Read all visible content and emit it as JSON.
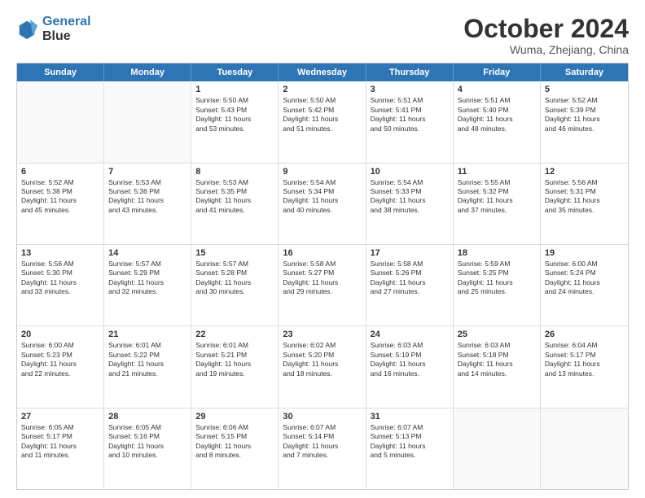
{
  "header": {
    "logo_line1": "General",
    "logo_line2": "Blue",
    "month_title": "October 2024",
    "location": "Wuma, Zhejiang, China"
  },
  "weekdays": [
    "Sunday",
    "Monday",
    "Tuesday",
    "Wednesday",
    "Thursday",
    "Friday",
    "Saturday"
  ],
  "weeks": [
    [
      {
        "day": "",
        "info": ""
      },
      {
        "day": "",
        "info": ""
      },
      {
        "day": "1",
        "info": "Sunrise: 5:50 AM\nSunset: 5:43 PM\nDaylight: 11 hours\nand 53 minutes."
      },
      {
        "day": "2",
        "info": "Sunrise: 5:50 AM\nSunset: 5:42 PM\nDaylight: 11 hours\nand 51 minutes."
      },
      {
        "day": "3",
        "info": "Sunrise: 5:51 AM\nSunset: 5:41 PM\nDaylight: 11 hours\nand 50 minutes."
      },
      {
        "day": "4",
        "info": "Sunrise: 5:51 AM\nSunset: 5:40 PM\nDaylight: 11 hours\nand 48 minutes."
      },
      {
        "day": "5",
        "info": "Sunrise: 5:52 AM\nSunset: 5:39 PM\nDaylight: 11 hours\nand 46 minutes."
      }
    ],
    [
      {
        "day": "6",
        "info": "Sunrise: 5:52 AM\nSunset: 5:38 PM\nDaylight: 11 hours\nand 45 minutes."
      },
      {
        "day": "7",
        "info": "Sunrise: 5:53 AM\nSunset: 5:36 PM\nDaylight: 11 hours\nand 43 minutes."
      },
      {
        "day": "8",
        "info": "Sunrise: 5:53 AM\nSunset: 5:35 PM\nDaylight: 11 hours\nand 41 minutes."
      },
      {
        "day": "9",
        "info": "Sunrise: 5:54 AM\nSunset: 5:34 PM\nDaylight: 11 hours\nand 40 minutes."
      },
      {
        "day": "10",
        "info": "Sunrise: 5:54 AM\nSunset: 5:33 PM\nDaylight: 11 hours\nand 38 minutes."
      },
      {
        "day": "11",
        "info": "Sunrise: 5:55 AM\nSunset: 5:32 PM\nDaylight: 11 hours\nand 37 minutes."
      },
      {
        "day": "12",
        "info": "Sunrise: 5:56 AM\nSunset: 5:31 PM\nDaylight: 11 hours\nand 35 minutes."
      }
    ],
    [
      {
        "day": "13",
        "info": "Sunrise: 5:56 AM\nSunset: 5:30 PM\nDaylight: 11 hours\nand 33 minutes."
      },
      {
        "day": "14",
        "info": "Sunrise: 5:57 AM\nSunset: 5:29 PM\nDaylight: 11 hours\nand 32 minutes."
      },
      {
        "day": "15",
        "info": "Sunrise: 5:57 AM\nSunset: 5:28 PM\nDaylight: 11 hours\nand 30 minutes."
      },
      {
        "day": "16",
        "info": "Sunrise: 5:58 AM\nSunset: 5:27 PM\nDaylight: 11 hours\nand 29 minutes."
      },
      {
        "day": "17",
        "info": "Sunrise: 5:58 AM\nSunset: 5:26 PM\nDaylight: 11 hours\nand 27 minutes."
      },
      {
        "day": "18",
        "info": "Sunrise: 5:59 AM\nSunset: 5:25 PM\nDaylight: 11 hours\nand 25 minutes."
      },
      {
        "day": "19",
        "info": "Sunrise: 6:00 AM\nSunset: 5:24 PM\nDaylight: 11 hours\nand 24 minutes."
      }
    ],
    [
      {
        "day": "20",
        "info": "Sunrise: 6:00 AM\nSunset: 5:23 PM\nDaylight: 11 hours\nand 22 minutes."
      },
      {
        "day": "21",
        "info": "Sunrise: 6:01 AM\nSunset: 5:22 PM\nDaylight: 11 hours\nand 21 minutes."
      },
      {
        "day": "22",
        "info": "Sunrise: 6:01 AM\nSunset: 5:21 PM\nDaylight: 11 hours\nand 19 minutes."
      },
      {
        "day": "23",
        "info": "Sunrise: 6:02 AM\nSunset: 5:20 PM\nDaylight: 11 hours\nand 18 minutes."
      },
      {
        "day": "24",
        "info": "Sunrise: 6:03 AM\nSunset: 5:19 PM\nDaylight: 11 hours\nand 16 minutes."
      },
      {
        "day": "25",
        "info": "Sunrise: 6:03 AM\nSunset: 5:18 PM\nDaylight: 11 hours\nand 14 minutes."
      },
      {
        "day": "26",
        "info": "Sunrise: 6:04 AM\nSunset: 5:17 PM\nDaylight: 11 hours\nand 13 minutes."
      }
    ],
    [
      {
        "day": "27",
        "info": "Sunrise: 6:05 AM\nSunset: 5:17 PM\nDaylight: 11 hours\nand 11 minutes."
      },
      {
        "day": "28",
        "info": "Sunrise: 6:05 AM\nSunset: 5:16 PM\nDaylight: 11 hours\nand 10 minutes."
      },
      {
        "day": "29",
        "info": "Sunrise: 6:06 AM\nSunset: 5:15 PM\nDaylight: 11 hours\nand 8 minutes."
      },
      {
        "day": "30",
        "info": "Sunrise: 6:07 AM\nSunset: 5:14 PM\nDaylight: 11 hours\nand 7 minutes."
      },
      {
        "day": "31",
        "info": "Sunrise: 6:07 AM\nSunset: 5:13 PM\nDaylight: 11 hours\nand 5 minutes."
      },
      {
        "day": "",
        "info": ""
      },
      {
        "day": "",
        "info": ""
      }
    ]
  ]
}
